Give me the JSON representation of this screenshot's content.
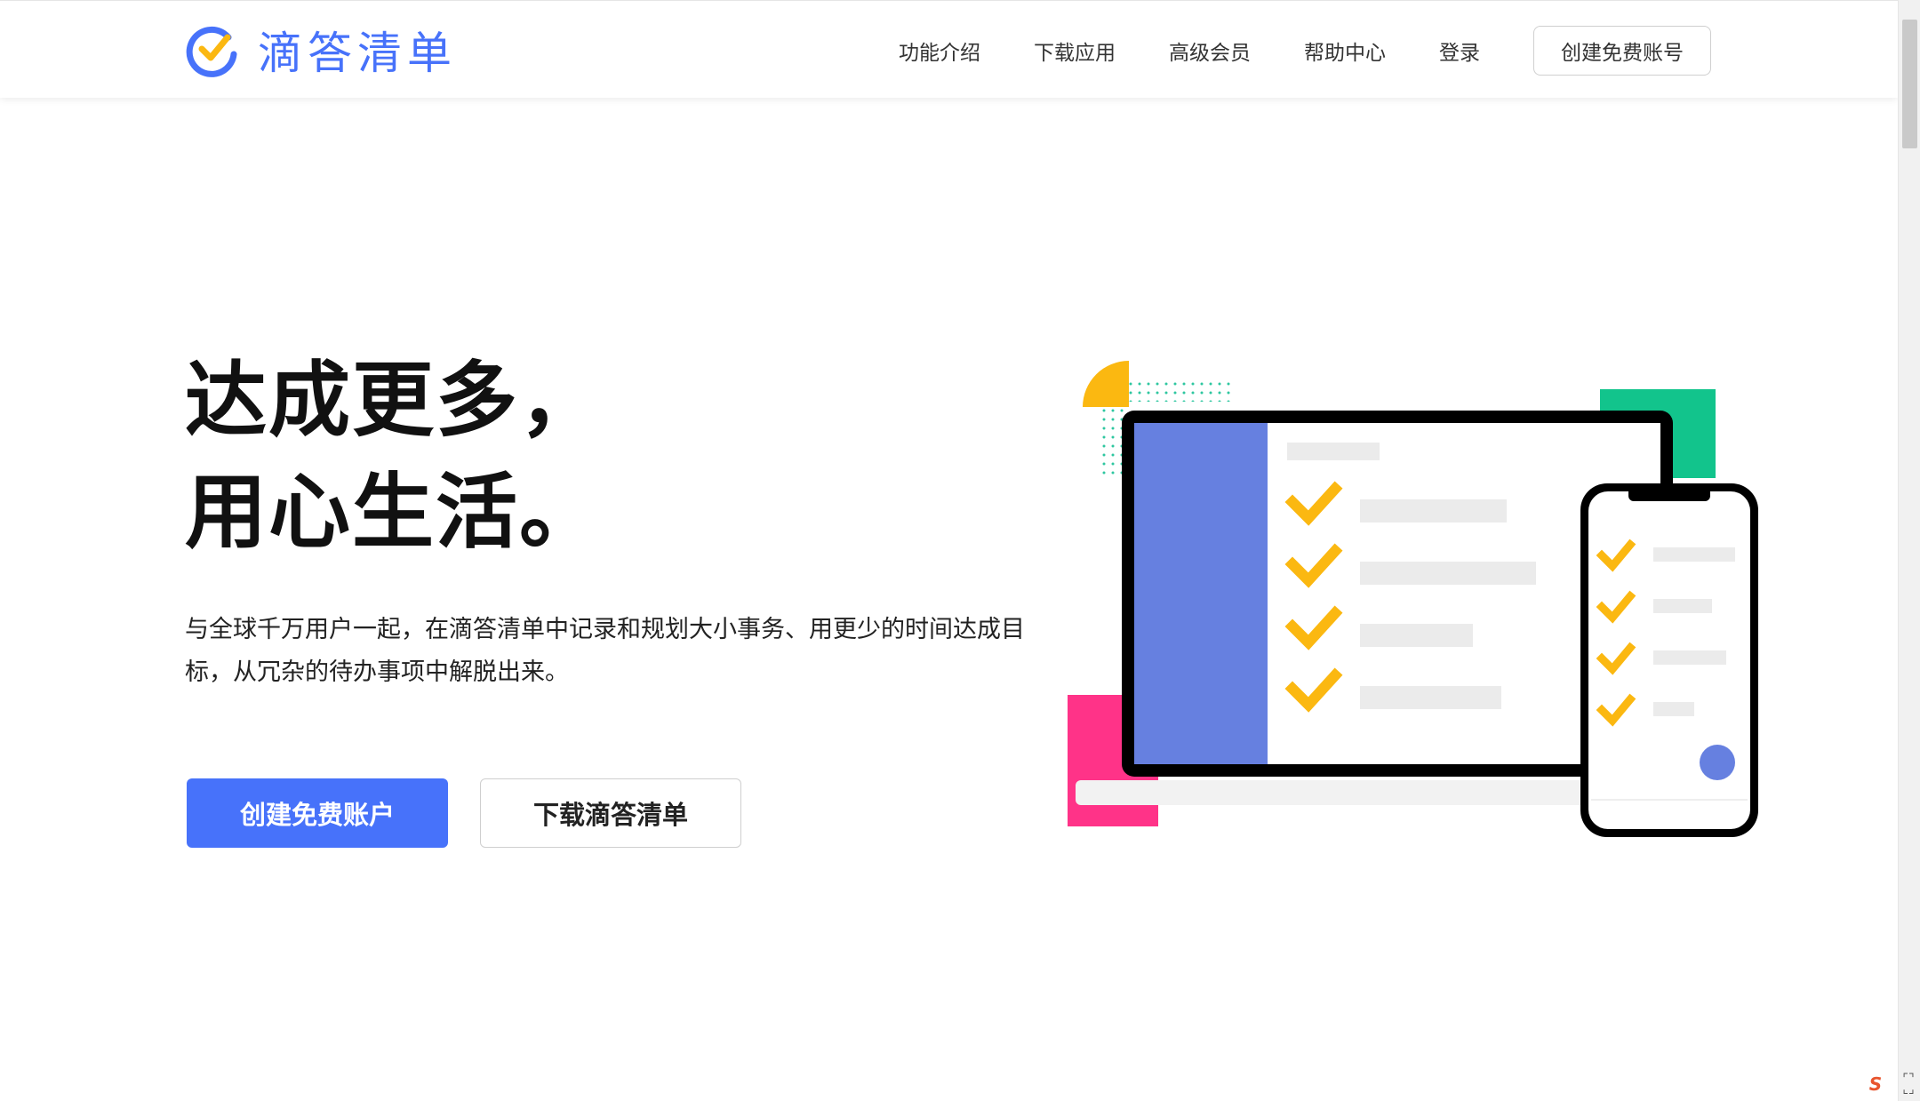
{
  "brand": {
    "name": "滴答清单",
    "color": "#4772fa",
    "accent": "#fbb811",
    "logo_icon": "check-circle-icon"
  },
  "nav": {
    "items": [
      "功能介绍",
      "下载应用",
      "高级会员",
      "帮助中心",
      "登录"
    ],
    "cta": "创建免费账号"
  },
  "hero": {
    "title_line1": "达成更多，",
    "title_line2": "用心生活。",
    "description": "与全球千万用户一起，在滴答清单中记录和规划大小事务、用更少的时间达成目标，从冗杂的待办事项中解脱出来。",
    "primary_button": "创建免费账户",
    "secondary_button": "下载滴答清单"
  },
  "illustration": {
    "colors": {
      "sidebar": "#6680e0",
      "check": "#fbb811",
      "green": "#12c48c",
      "pink": "#ff3388",
      "orange": "#fbb811",
      "dots": "#2ec7a0",
      "dot_button": "#6680e0"
    }
  },
  "tray": {
    "ime_label": "S"
  }
}
